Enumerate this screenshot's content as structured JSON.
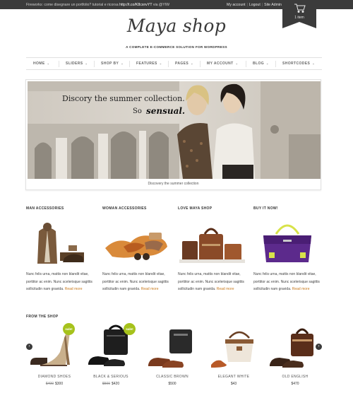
{
  "topbar": {
    "tweet_text": "Fireworks: come disegnare un portfolio? tutorial e ricorsa",
    "tweet_link": "http://t.co/K8cxnvYT",
    "tweet_via": "via @YIW",
    "my_account": "My account",
    "logout": "Logout",
    "site_admin": "Site Admin"
  },
  "cart": {
    "count_label": "1 item"
  },
  "logo": {
    "text": "Maya shop",
    "tagline": "A COMPLETE E-COMMERCE SOLUTION FOR WORDPRESS"
  },
  "nav": {
    "items": [
      {
        "label": "HOME"
      },
      {
        "label": "SLIDERS"
      },
      {
        "label": "SHOP BY"
      },
      {
        "label": "FEATURES"
      },
      {
        "label": "PAGES"
      },
      {
        "label": "MY ACCOUNT"
      },
      {
        "label": "BLOG"
      },
      {
        "label": "SHORTCODES"
      }
    ]
  },
  "slider": {
    "headline": "Discory the summer collection.",
    "sub1": "So",
    "sub2": "sensual.",
    "caption": "Discovery the summer collection"
  },
  "features": [
    {
      "heading": "MAN ACCESSORIES",
      "text": "Nunc felis urna, mattis non blandit vitae, porttitor ac enim. Nunc scelerisque sagittis sollicitudin nam gravida.",
      "more": "Read more"
    },
    {
      "heading": "WOMAN ACCESSORIES",
      "text": "Nunc felis urna, mattis non blandit vitae, porttitor ac enim. Nunc scelerisque sagittis sollicitudin nam gravida.",
      "more": "Read more"
    },
    {
      "heading": "LOVE MAYA SHOP",
      "text": "Nunc felis urna, mattis non blandit vitae, porttitor ac enim. Nunc scelerisque sagittis sollicitudin nam gravida.",
      "more": "Read more"
    },
    {
      "heading": "BUY IT NOW!",
      "text": "Nunc felis urna, mattis non blandit vitae, porttitor ac enim. Nunc scelerisque sagittis sollicitudin nam gravida.",
      "more": "Read more"
    }
  ],
  "shop": {
    "heading": "FROM THE SHOP",
    "prev_icon": "chevron-left-icon",
    "next_icon": "chevron-right-icon",
    "sale_label": "sale!",
    "products": [
      {
        "name": "DIAMOND SHOES",
        "old_price": "$400",
        "price": "$300",
        "sale": true
      },
      {
        "name": "BLACK & SERIOUS",
        "old_price": "$500",
        "price": "$420",
        "sale": true
      },
      {
        "name": "CLASSIC BROWN",
        "old_price": "",
        "price": "$500",
        "sale": false
      },
      {
        "name": "ELEGANT WHITE",
        "old_price": "",
        "price": "$43",
        "sale": false
      },
      {
        "name": "OLD ENGLISH",
        "old_price": "",
        "price": "$470",
        "sale": false
      }
    ]
  },
  "colors": {
    "accent": "#c8791c",
    "sale_badge": "#a6c21c",
    "topbar": "#3b3b3b"
  }
}
